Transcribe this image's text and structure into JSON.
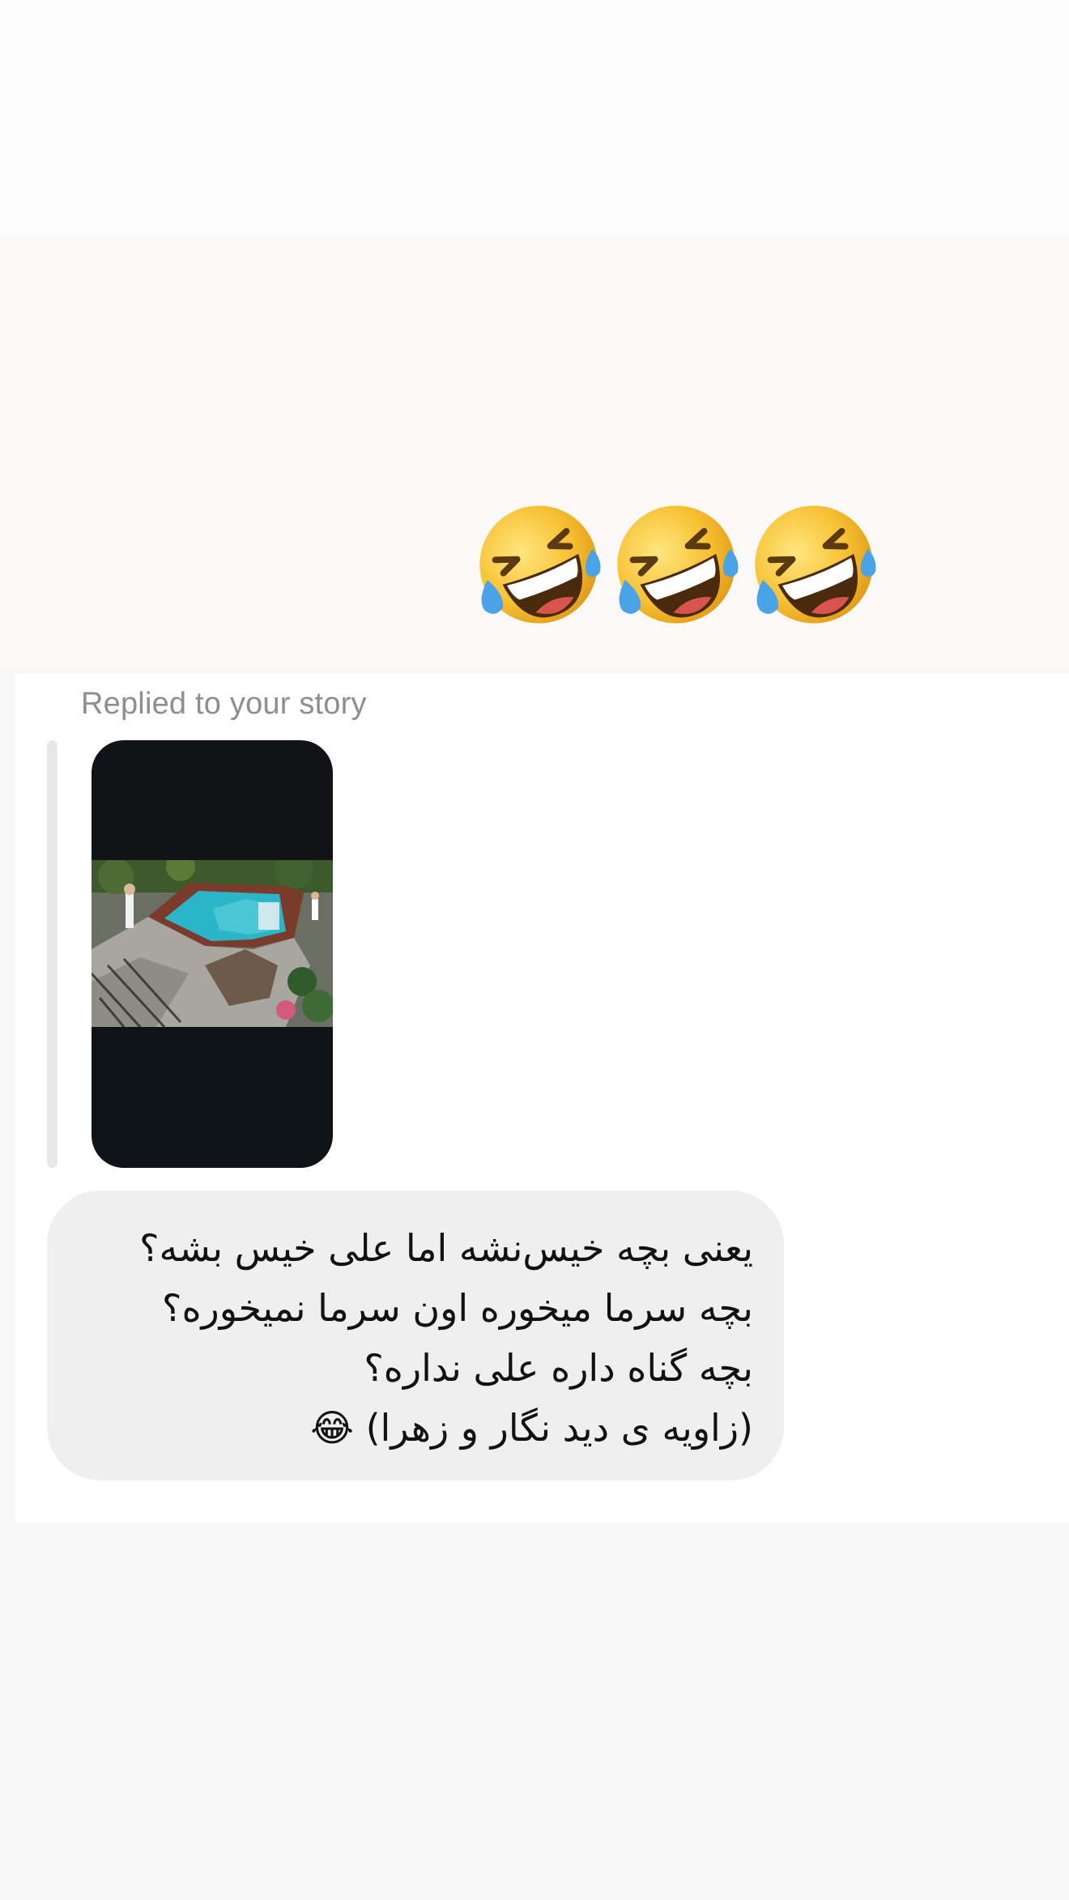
{
  "emoji_message": {
    "emoji_count": 3,
    "icon": "rolling-on-floor-laughing-icon"
  },
  "story_reply": {
    "label": "Replied to your story",
    "thumbnail_alt": "Story preview",
    "message": "یعنی بچه خیس‌نشه اما علی خیس بشه؟\nبچه سرما میخوره اون سرما نمیخوره؟\nبچه گناه داره علی نداره؟\n(زاویه ی دید نگار و زهرا) 😂"
  },
  "colors": {
    "bubble": "#efefef",
    "label": "#8e8e8e",
    "text": "#111111",
    "pool": "#2bb5c8"
  }
}
